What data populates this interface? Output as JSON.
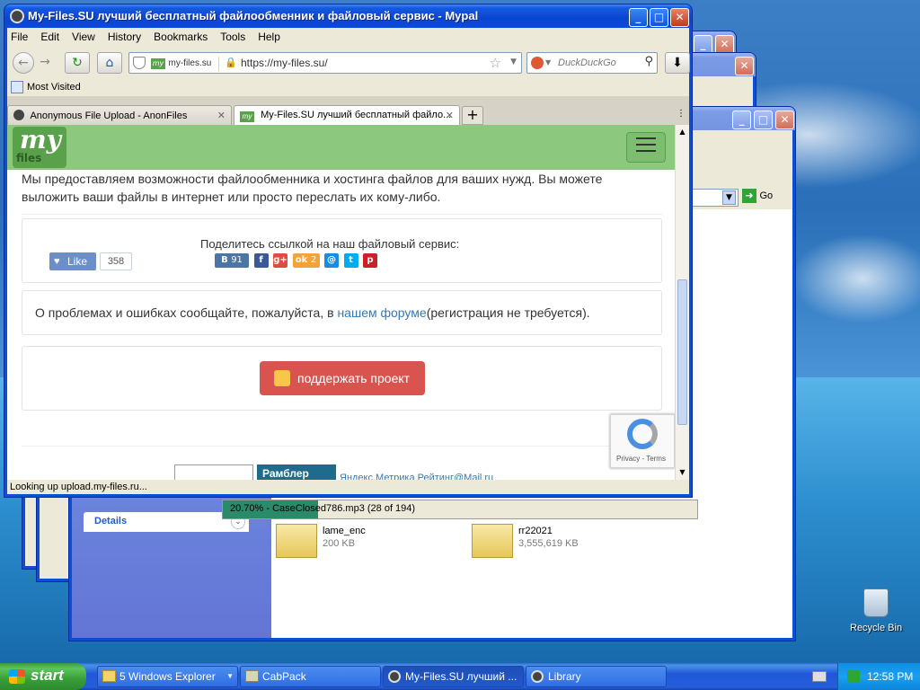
{
  "browser": {
    "title": "My-Files.SU лучший бесплатный файлообменник и файловый сервис - Mypal",
    "menu": [
      "File",
      "Edit",
      "View",
      "History",
      "Bookmarks",
      "Tools",
      "Help"
    ],
    "site_identity": "my-files.su",
    "url": "https://my-files.su/",
    "search_placeholder": "DuckDuckGo",
    "bookmark": "Most Visited",
    "tabs": [
      {
        "label": "Anonymous File Upload - AnonFiles"
      },
      {
        "label": "My-Files.SU лучший бесплатный файло..."
      }
    ],
    "status": "Looking up upload.my-files.ru..."
  },
  "page": {
    "logo_top": "my",
    "logo_bottom": "files",
    "intro": "Мы предоставляем возможности файлообменника и хостинга файлов для ваших нужд. Вы можете выложить ваши файлы в интернет или просто переслать их кому-либо.",
    "share_title": "Поделитесь ссылкой на наш файловый сервис:",
    "like_label": "Like",
    "like_count": "358",
    "vk_count": "91",
    "ok_count": "2",
    "report_prefix": "О проблемах и ошибках сообщайте, пожалуйста, в",
    "report_link": "нашем форуме",
    "report_suffix": "(регистрация не требуется).",
    "support_button": "поддержать проект",
    "footer_rambler": "Рамблер",
    "footer_links": "Яндекс.Метрика Рейтинг@Mail.ru",
    "recaptcha": "Privacy - Terms"
  },
  "explorer": {
    "go_label": "Go",
    "details_label": "Details",
    "progress_text": "20.70% - CaseClosed786.mp3 (28 of 194)",
    "files": [
      {
        "name": "lame_enc",
        "size": "200 KB"
      },
      {
        "name": "rr22021",
        "size": "3,555,619 KB"
      }
    ]
  },
  "desktop": {
    "recycle_bin": "Recycle Bin"
  },
  "taskbar": {
    "start": "start",
    "items": [
      {
        "label": "5 Windows Explorer"
      },
      {
        "label": "CabPack"
      },
      {
        "label": "My-Files.SU лучший ..."
      },
      {
        "label": "Library"
      }
    ],
    "clock": "12:58 PM"
  }
}
